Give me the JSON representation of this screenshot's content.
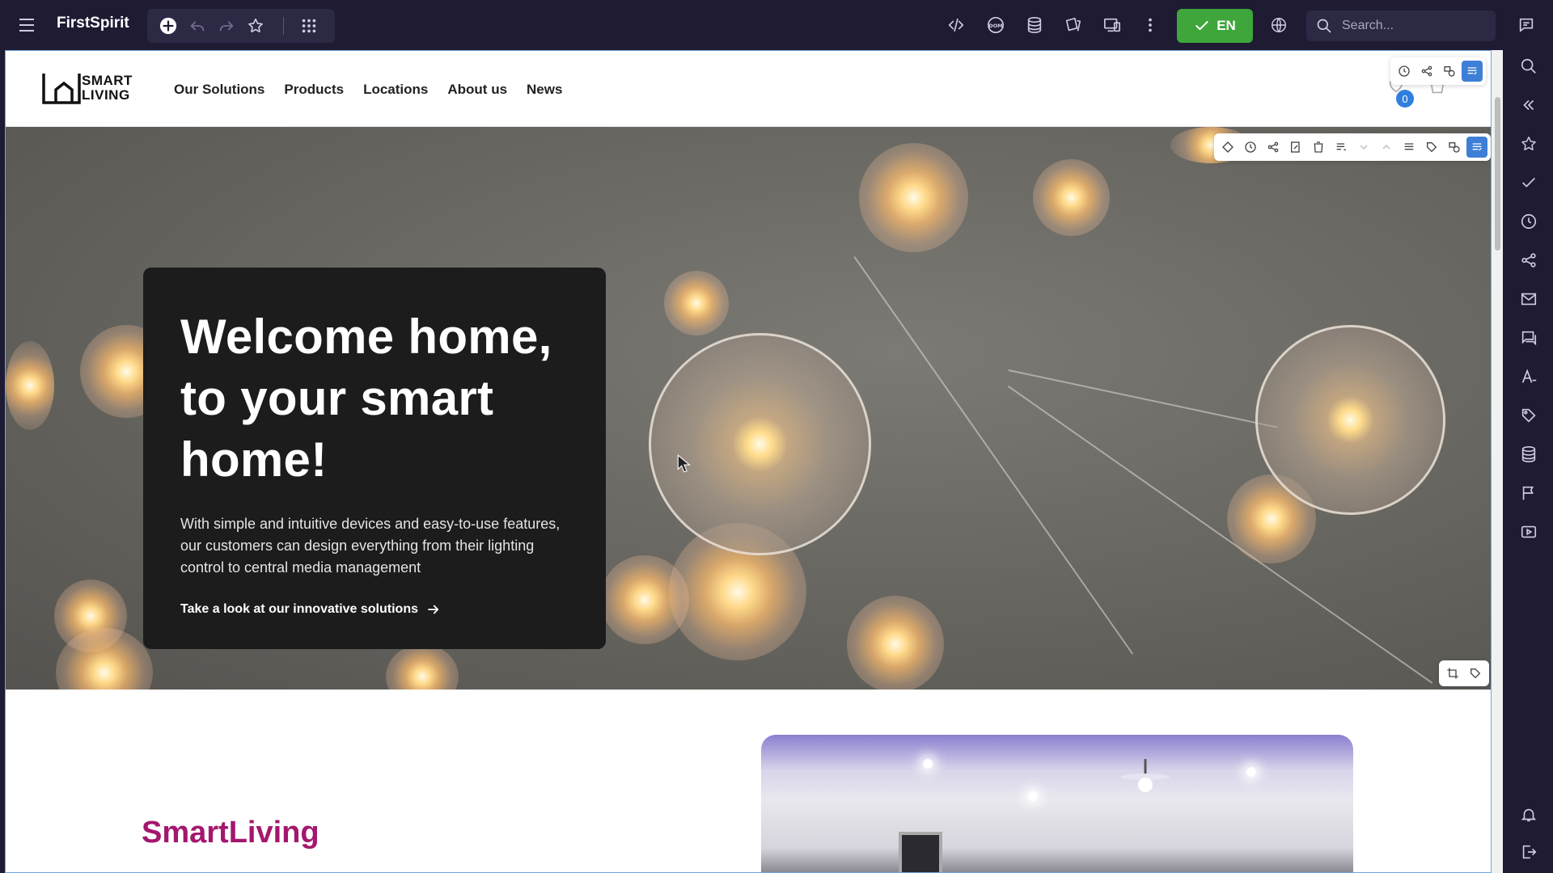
{
  "app": {
    "title": "FirstSpirit",
    "language_button": "EN",
    "search_placeholder": "Search..."
  },
  "toolbar": {
    "left_icons": [
      "add-icon",
      "undo-icon",
      "redo-icon",
      "star-icon",
      "apps-grid-icon"
    ],
    "right_icons": [
      "code-icon",
      "dom-icon",
      "database-icon",
      "pages-icon",
      "devices-icon",
      "more-vertical-icon"
    ]
  },
  "side_rail": {
    "icons": [
      "search-icon",
      "collapse-icon",
      "star-icon",
      "check-icon",
      "history-icon",
      "share-icon",
      "mail-icon",
      "comments-icon",
      "translate-icon",
      "tags-icon",
      "database-icon",
      "flag-icon",
      "video-icon",
      "bell-icon",
      "logout-icon"
    ]
  },
  "site": {
    "logo": "SMART LIVING",
    "nav": [
      "Our Solutions",
      "Products",
      "Locations",
      "About us",
      "News"
    ],
    "cart_count": "0",
    "hero": {
      "title": "Welcome home, to your smart home!",
      "text": "With simple and intuitive devices and easy-to-use features, our customers can design everything from their lighting control to central media management",
      "link": "Take a look at our innovative solutions"
    },
    "section": {
      "title": "SmartLiving"
    }
  },
  "colors": {
    "app_bg": "#1e1b33",
    "publish_green": "#3ea63b",
    "accent_blue": "#3d7fd6",
    "section_title": "#a4176e"
  }
}
